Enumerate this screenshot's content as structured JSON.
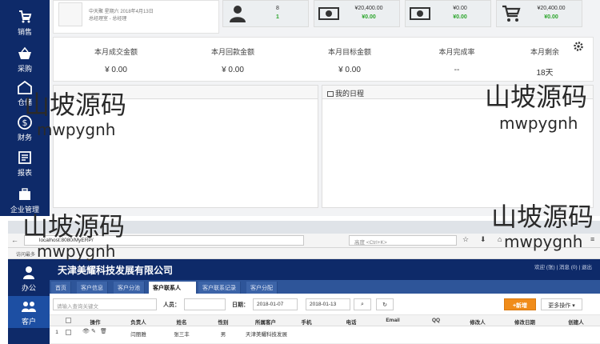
{
  "top": {
    "user": {
      "meta_line1": "中天聚 星期六 2018年4月13日",
      "meta_line2": "总经理室 - 总经理"
    },
    "stats": [
      {
        "icon": "user-icon",
        "line1": "8",
        "line2": "1"
      },
      {
        "icon": "money-icon",
        "line1": "¥20,400.00",
        "line2": "¥0.00"
      },
      {
        "icon": "money-icon",
        "line1": "¥0.00",
        "line2": "¥0.00"
      },
      {
        "icon": "cart-icon",
        "line1": "¥20,400.00",
        "line2": "¥0.00"
      }
    ],
    "sidebar": [
      {
        "label": "销售",
        "icon": "sales-icon"
      },
      {
        "label": "采购",
        "icon": "basket-icon"
      },
      {
        "label": "仓储",
        "icon": "warehouse-icon"
      },
      {
        "label": "财务",
        "icon": "dollar-icon"
      },
      {
        "label": "报表",
        "icon": "report-icon"
      },
      {
        "label": "企业管理",
        "icon": "briefcase-icon"
      }
    ],
    "metrics": [
      {
        "label": "本月成交金额",
        "value": "¥ 0.00"
      },
      {
        "label": "本月回款金额",
        "value": "¥ 0.00"
      },
      {
        "label": "本月目标金额",
        "value": "¥ 0.00"
      },
      {
        "label": "本月完成率",
        "value": "--"
      },
      {
        "label": "本月剩余",
        "value": "18天"
      }
    ],
    "panel_right_title": "我的日程"
  },
  "browser": {
    "address": "localhost:8080/MyERP/",
    "search_placeholder": "高度 <Ctrl+K>",
    "bookmark": "访问最多"
  },
  "app": {
    "company": "天津美耀科技发展有限公司",
    "header_links": "欢迎 (张) | 消息 (0) | 退出",
    "sidebar": [
      {
        "label": "办公",
        "icon": "person-icon"
      },
      {
        "label": "客户",
        "icon": "customers-icon"
      }
    ],
    "tabs": [
      "首页",
      "客户信息",
      "客户分池",
      "客户联系人",
      "客户联系记录",
      "客户分配"
    ],
    "active_tab": "客户联系人",
    "toolbar": {
      "search_placeholder": "请输入查询关键文",
      "person_label": "人员：",
      "date_label": "日期：",
      "date_from": "2018-01-07",
      "date_to": "2018-01-13",
      "new_button": "+新增",
      "more_button": "更多操作 ▾"
    },
    "columns": [
      "操作",
      "负责人",
      "姓名",
      "性别",
      "所属客户",
      "手机",
      "电话",
      "Email",
      "QQ",
      "修改人",
      "修改日期",
      "创建人"
    ],
    "rows": [
      {
        "index": "1",
        "owner": "闫丽雅",
        "name": "张三丰",
        "gender": "男",
        "customer": "天津美耀科技发展"
      }
    ]
  },
  "watermark": {
    "line1": "山坡源码",
    "line2": "mwpygnh"
  },
  "colors": {
    "nav": "#0e2a69",
    "tabbar": "#2e5599",
    "accent": "#f08c1a",
    "green": "#2aa52a"
  }
}
